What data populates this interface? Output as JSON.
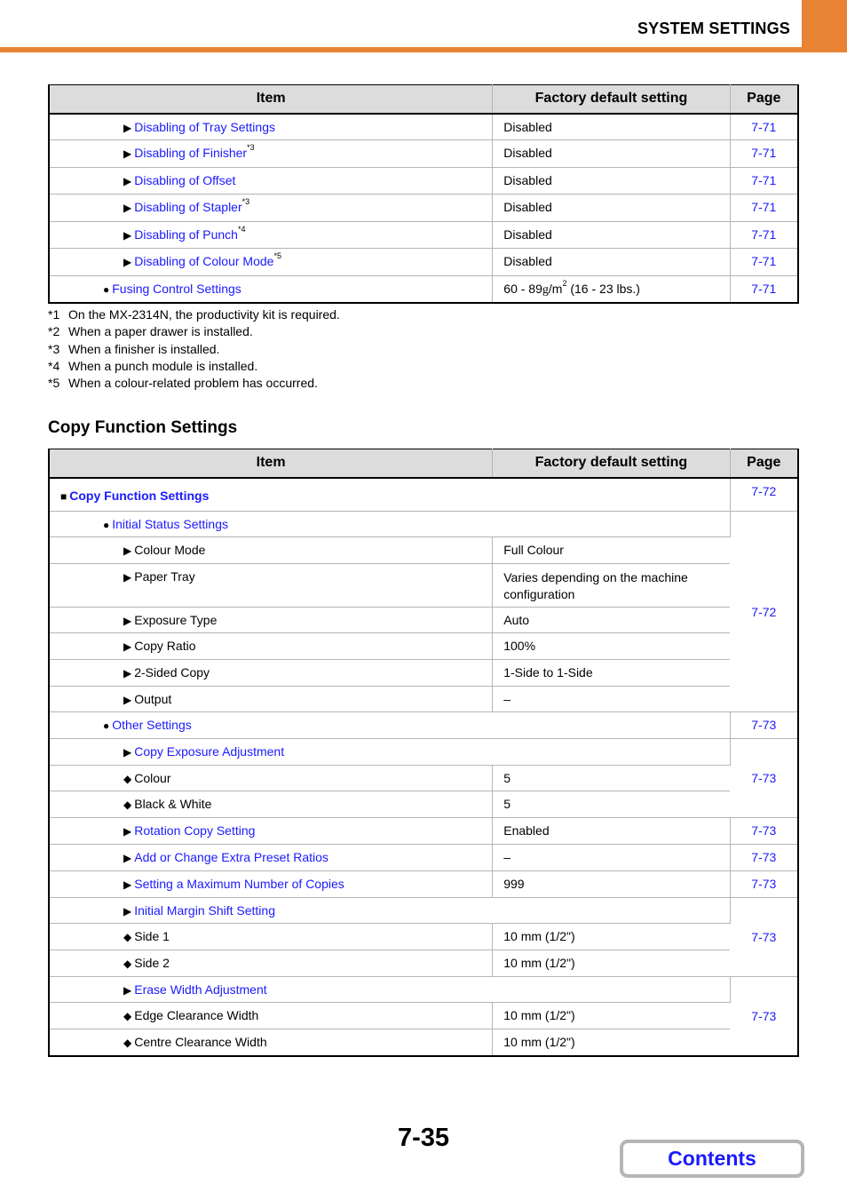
{
  "header": {
    "title": "SYSTEM SETTINGS",
    "accent_color": "#e88334"
  },
  "table1": {
    "columns": [
      "Item",
      "Factory default setting",
      "Page"
    ],
    "rows": [
      {
        "bullet": "▶",
        "label": "Disabling of Tray Settings",
        "note": "",
        "default": "Disabled",
        "page": "7-71"
      },
      {
        "bullet": "▶",
        "label": "Disabling of Finisher",
        "note": "*3",
        "default": "Disabled",
        "page": "7-71"
      },
      {
        "bullet": "▶",
        "label": "Disabling of Offset",
        "note": "",
        "default": "Disabled",
        "page": "7-71"
      },
      {
        "bullet": "▶",
        "label": "Disabling of Stapler",
        "note": "*3",
        "default": "Disabled",
        "page": "7-71"
      },
      {
        "bullet": "▶",
        "label": "Disabling of Punch",
        "note": "*4",
        "default": "Disabled",
        "page": "7-71"
      },
      {
        "bullet": "▶",
        "label": "Disabling of Colour Mode",
        "note": "*5",
        "default": "Disabled",
        "page": "7-71"
      },
      {
        "bullet": "●",
        "label": "Fusing Control Settings",
        "note": "",
        "default_pre": "60 - 89",
        "default_unit": "g",
        "default_mid": "/m",
        "default_sup": "2",
        "default_post": " (16 - 23 lbs.)",
        "page": "7-71"
      }
    ]
  },
  "footnotes": [
    {
      "mark": "*1",
      "text": "On the MX-2314N, the productivity kit is required."
    },
    {
      "mark": "*2",
      "text": "When a paper drawer is installed."
    },
    {
      "mark": "*3",
      "text": "When a finisher is installed."
    },
    {
      "mark": "*4",
      "text": "When a punch module is installed."
    },
    {
      "mark": "*5",
      "text": "When a colour-related problem has occurred."
    }
  ],
  "section_title": "Copy Function Settings",
  "table2": {
    "columns": [
      "Item",
      "Factory default setting",
      "Page"
    ],
    "rows": [
      {
        "bullet": "■",
        "label": "Copy Function Settings",
        "default": "",
        "page": "7-72"
      },
      {
        "bullet": "●",
        "label": "Initial Status Settings",
        "default": ""
      },
      {
        "bullet": "▶",
        "label": "Colour Mode",
        "default": "Full Colour"
      },
      {
        "bullet": "▶",
        "label": "Paper Tray",
        "default": "Varies depending on the machine configuration"
      },
      {
        "bullet": "▶",
        "label": "Exposure Type",
        "default": "Auto"
      },
      {
        "bullet": "▶",
        "label": "Copy Ratio",
        "default": "100%"
      },
      {
        "bullet": "▶",
        "label": "2-Sided Copy",
        "default": "1-Side to 1-Side"
      },
      {
        "bullet": "▶",
        "label": "Output",
        "default": "–"
      },
      {
        "bullet": "●",
        "label": "Other Settings",
        "default": "",
        "page": "7-73"
      },
      {
        "bullet": "▶",
        "label": "Copy Exposure Adjustment",
        "default": ""
      },
      {
        "bullet": "◆",
        "label": "Colour",
        "default": "5"
      },
      {
        "bullet": "◆",
        "label": "Black & White",
        "default": "5"
      },
      {
        "bullet": "▶",
        "label": "Rotation Copy Setting",
        "default": "Enabled",
        "page": "7-73"
      },
      {
        "bullet": "▶",
        "label": "Add or Change Extra Preset Ratios",
        "default": "–",
        "page": "7-73"
      },
      {
        "bullet": "▶",
        "label": "Setting a Maximum Number of Copies",
        "default": "999",
        "page": "7-73"
      },
      {
        "bullet": "▶",
        "label": "Initial Margin Shift Setting",
        "default": ""
      },
      {
        "bullet": "◆",
        "label": "Side 1",
        "default": "10 mm (1/2\")"
      },
      {
        "bullet": "◆",
        "label": "Side 2",
        "default": "10 mm (1/2\")"
      },
      {
        "bullet": "▶",
        "label": "Erase Width Adjustment",
        "default": ""
      },
      {
        "bullet": "◆",
        "label": "Edge Clearance Width",
        "default": "10 mm (1/2\")"
      },
      {
        "bullet": "◆",
        "label": "Centre Clearance Width",
        "default": "10 mm (1/2\")"
      }
    ],
    "group_pages": {
      "initial_status": "7-72",
      "copy_exposure": "7-73",
      "margin_shift": "7-73",
      "erase_width": "7-73"
    }
  },
  "footer": {
    "page_number": "7-35",
    "contents_label": "Contents"
  }
}
